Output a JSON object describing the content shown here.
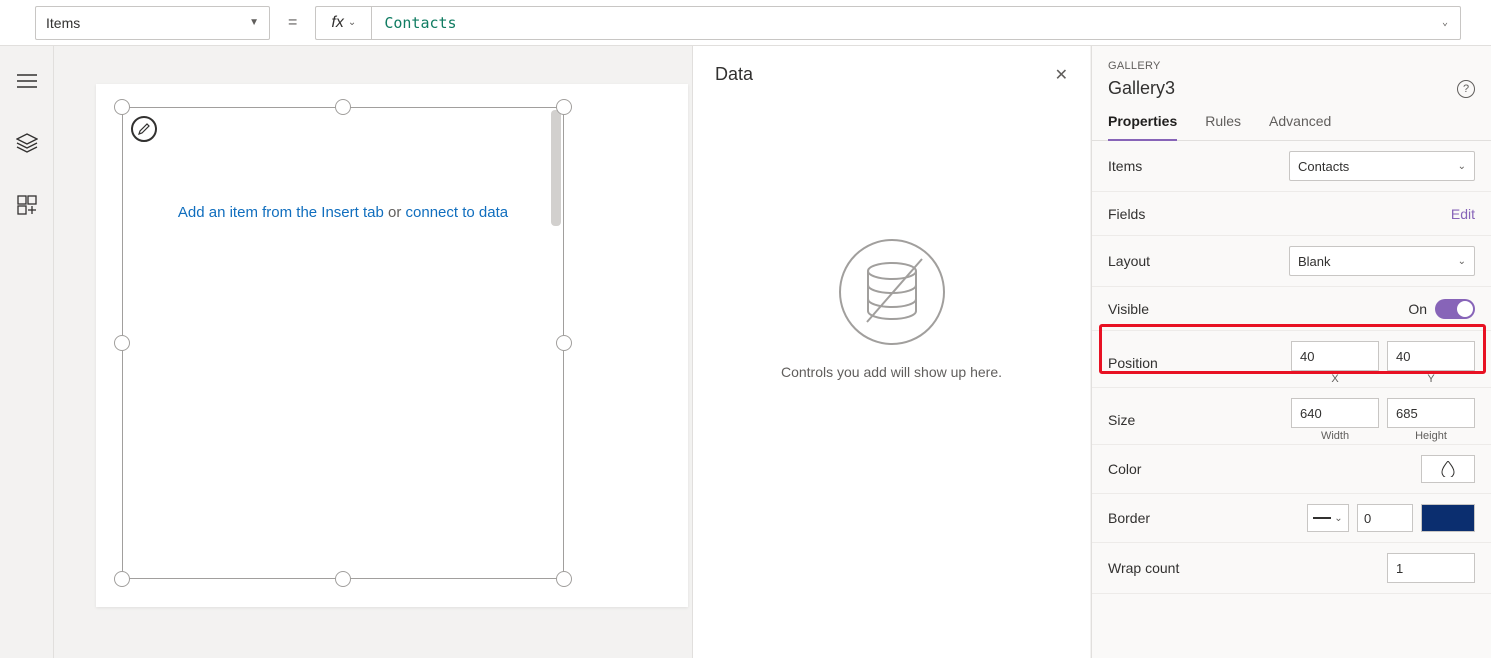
{
  "formula": {
    "property": "Items",
    "fx": "fx",
    "value": "Contacts"
  },
  "canvas": {
    "hint_action": "Add an item from the Insert tab",
    "hint_or": " or ",
    "hint_connect": "connect to data"
  },
  "dataPanel": {
    "title": "Data",
    "message": "Controls you add will show up here."
  },
  "props": {
    "section": "GALLERY",
    "name": "Gallery3",
    "tabs": {
      "properties": "Properties",
      "rules": "Rules",
      "advanced": "Advanced"
    },
    "items_label": "Items",
    "items_value": "Contacts",
    "fields_label": "Fields",
    "fields_edit": "Edit",
    "layout_label": "Layout",
    "layout_value": "Blank",
    "visible_label": "Visible",
    "visible_value": "On",
    "position_label": "Position",
    "pos_x": "40",
    "pos_y": "40",
    "x_label": "X",
    "y_label": "Y",
    "size_label": "Size",
    "width": "640",
    "height": "685",
    "w_label": "Width",
    "h_label": "Height",
    "color_label": "Color",
    "border_label": "Border",
    "border_width": "0",
    "wrap_label": "Wrap count",
    "wrap_value": "1"
  }
}
